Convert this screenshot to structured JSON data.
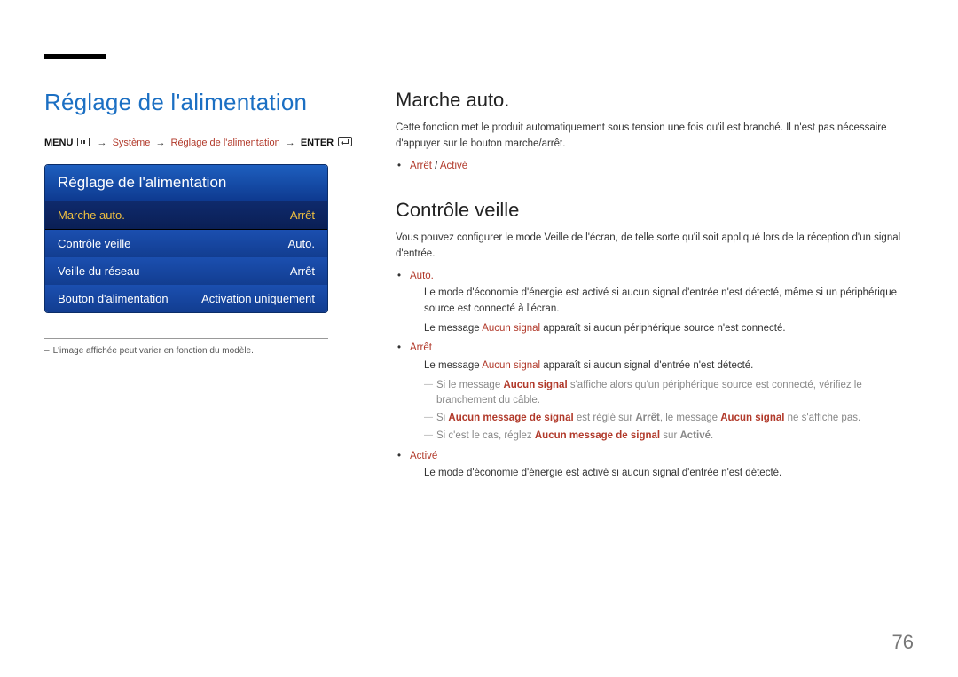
{
  "page_number": "76",
  "left": {
    "title": "Réglage de l'alimentation",
    "menupath": {
      "menu": "MENU",
      "sys": "Système",
      "setting": "Réglage de l'alimentation",
      "enter": "ENTER"
    },
    "osd": {
      "title": "Réglage de l'alimentation",
      "rows": [
        {
          "label": "Marche auto.",
          "value": "Arrêt",
          "selected": true
        },
        {
          "label": "Contrôle veille",
          "value": "Auto.",
          "selected": false
        },
        {
          "label": "Veille du réseau",
          "value": "Arrêt",
          "selected": false
        },
        {
          "label": "Bouton d'alimentation",
          "value": "Activation uniquement",
          "selected": false
        }
      ]
    },
    "footnote": "L'image affichée peut varier en fonction du modèle."
  },
  "right": {
    "s1": {
      "heading": "Marche auto.",
      "para": "Cette fonction met le produit automatiquement sous tension une fois qu'il est branché. Il n'est pas nécessaire d'appuyer sur le bouton marche/arrêt.",
      "opt_off": "Arrêt",
      "opt_on": "Activé"
    },
    "s2": {
      "heading": "Contrôle veille",
      "para": "Vous pouvez configurer le mode Veille de l'écran, de telle sorte qu'il soit appliqué lors de la réception d'un signal d'entrée.",
      "auto": {
        "label": "Auto.",
        "line1": "Le mode d'économie d'énergie est activé si aucun signal d'entrée n'est détecté, même si un périphérique source est connecté à l'écran.",
        "line2_pre": "Le message ",
        "line2_red": "Aucun signal",
        "line2_post": " apparaît si aucun périphérique source n'est connecté."
      },
      "off": {
        "label": "Arrêt",
        "line1_pre": "Le message ",
        "line1_red": "Aucun signal",
        "line1_post": " apparaît si aucun signal d'entrée n'est détecté.",
        "note1_pre": "Si le message ",
        "note1_red": "Aucun signal",
        "note1_post": " s'affiche alors qu'un périphérique source est connecté, vérifiez le branchement du câble.",
        "note2_a": "Si ",
        "note2_b": "Aucun message de signal",
        "note2_c": " est réglé sur ",
        "note2_d": "Arrêt",
        "note2_e": ", le message ",
        "note2_f": "Aucun signal",
        "note2_g": " ne s'affiche pas.",
        "note3_a": "Si c'est le cas, réglez ",
        "note3_b": "Aucun message de signal",
        "note3_c": " sur ",
        "note3_d": "Activé",
        "note3_e": "."
      },
      "on": {
        "label": "Activé",
        "line": "Le mode d'économie d'énergie est activé si aucun signal d'entrée n'est détecté."
      }
    }
  }
}
